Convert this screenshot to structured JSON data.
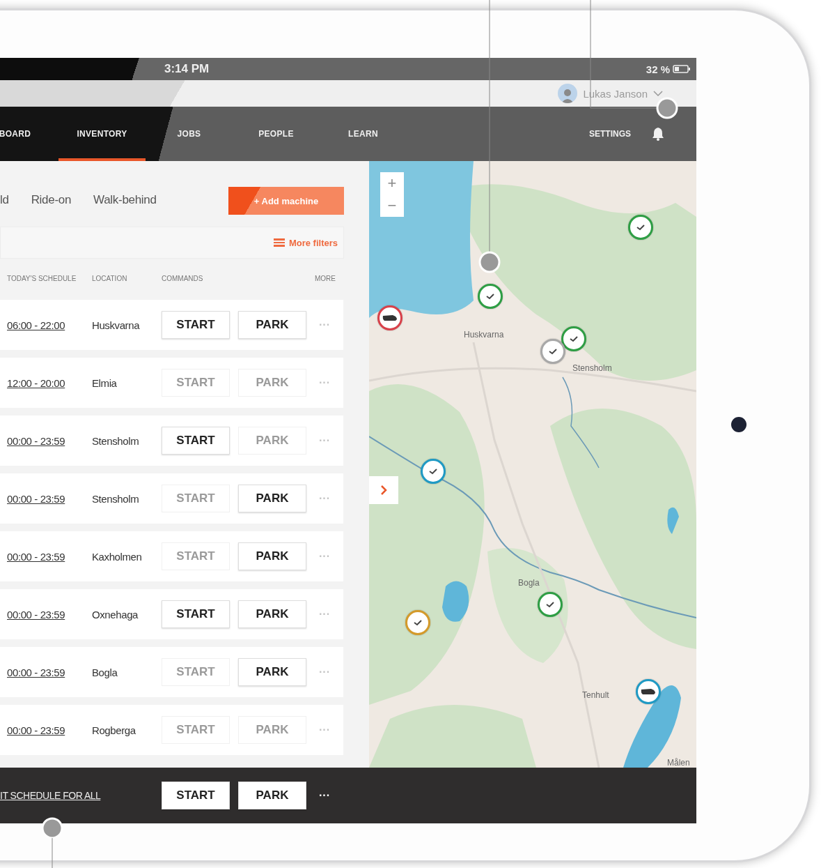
{
  "status_bar": {
    "time": "3:14 PM",
    "battery": "32 %"
  },
  "user": {
    "name": "Lukas Janson"
  },
  "nav": {
    "items": [
      {
        "label": "BOARD",
        "selected": false
      },
      {
        "label": "INVENTORY",
        "selected": true
      },
      {
        "label": "JOBS",
        "selected": false
      },
      {
        "label": "PEOPLE",
        "selected": false
      },
      {
        "label": "LEARN",
        "selected": false
      }
    ],
    "settings": "SETTINGS"
  },
  "filters": {
    "tabs": [
      {
        "label": "ld",
        "selected": false
      },
      {
        "label": "Ride-on",
        "selected": false
      },
      {
        "label": "Walk-behind",
        "selected": false
      }
    ],
    "add_button": "+ Add machine",
    "more_filters": "More filters"
  },
  "table": {
    "columns": [
      "TODAY'S SCHEDULE",
      "LOCATION",
      "COMMANDS",
      "MORE"
    ],
    "rows": [
      {
        "schedule": "06:00 - 22:00",
        "location": "Huskvarna",
        "commands": [
          {
            "label": "START",
            "disabled": false
          },
          {
            "label": "PARK",
            "disabled": false
          }
        ],
        "more": "···"
      },
      {
        "schedule": "12:00 - 20:00",
        "location": "Elmia",
        "commands": [
          {
            "label": "START",
            "disabled": true
          },
          {
            "label": "PARK",
            "disabled": true
          }
        ],
        "more": "···"
      },
      {
        "schedule": "00:00 - 23:59",
        "location": "Stensholm",
        "commands": [
          {
            "label": "START",
            "disabled": false
          },
          {
            "label": "PARK",
            "disabled": true
          }
        ],
        "more": "···"
      },
      {
        "schedule": "00:00 - 23:59",
        "location": "Stensholm",
        "commands": [
          {
            "label": "START",
            "disabled": true
          },
          {
            "label": "PARK",
            "disabled": false
          }
        ],
        "more": "···"
      },
      {
        "schedule": "00:00 - 23:59",
        "location": "Kaxholmen",
        "commands": [
          {
            "label": "START",
            "disabled": true
          },
          {
            "label": "PARK",
            "disabled": false
          }
        ],
        "more": "···"
      },
      {
        "schedule": "00:00 - 23:59",
        "location": "Oxnehaga",
        "commands": [
          {
            "label": "START",
            "disabled": false
          },
          {
            "label": "PARK",
            "disabled": false
          }
        ],
        "more": "···"
      },
      {
        "schedule": "00:00 - 23:59",
        "location": "Bogla",
        "commands": [
          {
            "label": "START",
            "disabled": true
          },
          {
            "label": "PARK",
            "disabled": false
          }
        ],
        "more": "···"
      },
      {
        "schedule": "00:00 - 23:59",
        "location": "Rogberga",
        "commands": [
          {
            "label": "START",
            "disabled": true
          },
          {
            "label": "PARK",
            "disabled": true
          }
        ],
        "more": "···"
      }
    ]
  },
  "map": {
    "zoom": [
      "+",
      "−"
    ],
    "places": [
      "Huskvarna",
      "Stensholm",
      "Bogla",
      "Tenhult",
      "Målen"
    ],
    "markers": [
      {
        "kind": "check",
        "color": "#2e9e44"
      },
      {
        "kind": "check",
        "color": "#2e9e44"
      },
      {
        "kind": "mower",
        "color": "#d9414a"
      },
      {
        "kind": "check",
        "color": "#2e9e44"
      },
      {
        "kind": "check",
        "color": "#a8a8a8"
      },
      {
        "kind": "check",
        "color": "#1f9ac4"
      },
      {
        "kind": "check",
        "color": "#2e9e44"
      },
      {
        "kind": "check",
        "color": "#d49a2a"
      },
      {
        "kind": "mower",
        "color": "#1f9ac4"
      }
    ]
  },
  "bottom_bar": {
    "link": "IT SCHEDULE FOR ALL",
    "commands": [
      {
        "label": "START",
        "disabled": false
      },
      {
        "label": "PARK",
        "disabled": false
      }
    ],
    "more": "···"
  }
}
